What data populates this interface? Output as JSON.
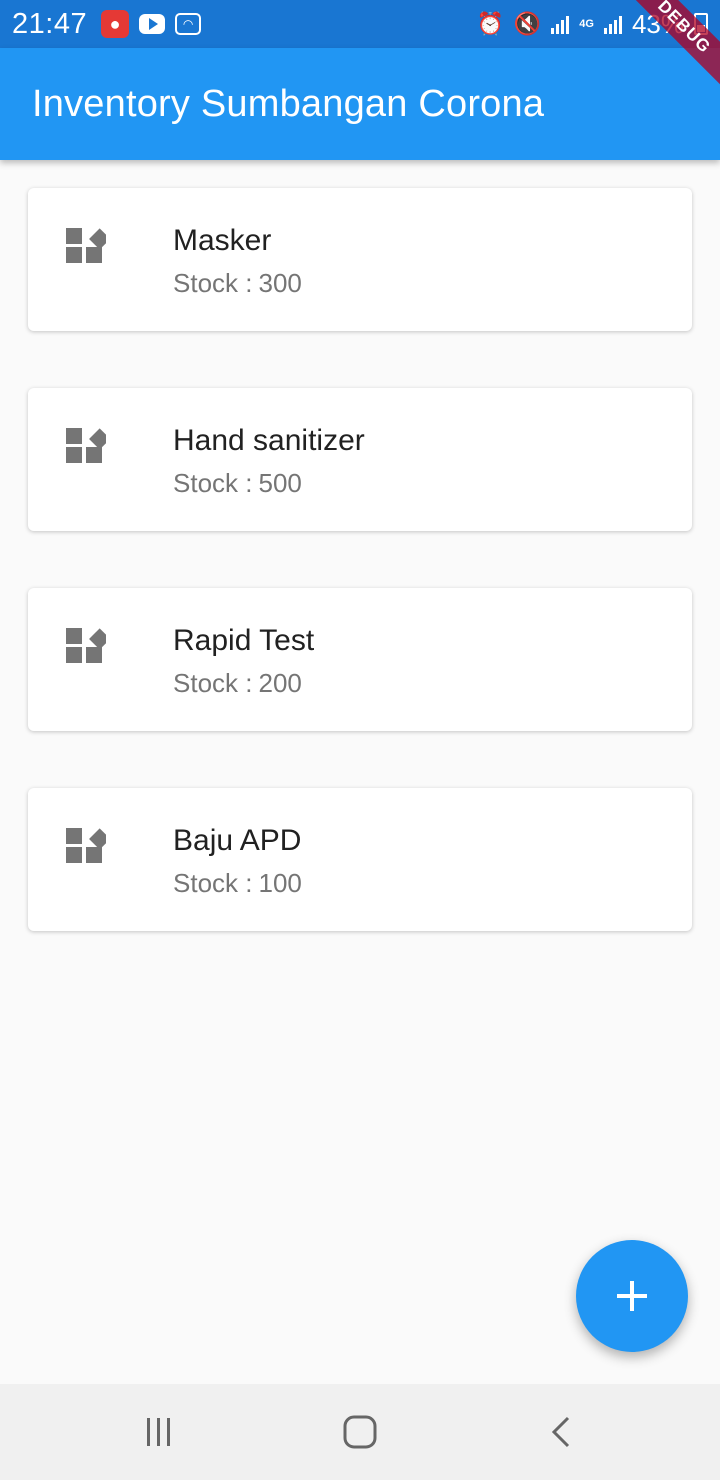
{
  "status_bar": {
    "time": "21:47",
    "battery": "43%",
    "network": "4G",
    "icons": [
      "app-notification-icon",
      "youtube-icon",
      "wifi-icon",
      "alarm-icon",
      "mute-icon",
      "signal-icon",
      "signal-icon",
      "battery-icon"
    ]
  },
  "debug_banner": "DEBUG",
  "app_bar": {
    "title": "Inventory Sumbangan Corona"
  },
  "items": [
    {
      "name": "Masker",
      "stock_label": "Stock :",
      "stock": 300
    },
    {
      "name": "Hand sanitizer",
      "stock_label": "Stock :",
      "stock": 500
    },
    {
      "name": "Rapid Test",
      "stock_label": "Stock :",
      "stock": 200
    },
    {
      "name": "Baju APD",
      "stock_label": "Stock :",
      "stock": 100
    }
  ],
  "fab": {
    "icon": "plus-icon"
  },
  "nav_bar": {
    "icons": [
      "recent-apps-icon",
      "home-icon",
      "back-icon"
    ]
  },
  "colors": {
    "primary": "#2196f3",
    "status_bar": "#1976d2",
    "background": "#fafafa",
    "icon_grey": "#757575"
  }
}
